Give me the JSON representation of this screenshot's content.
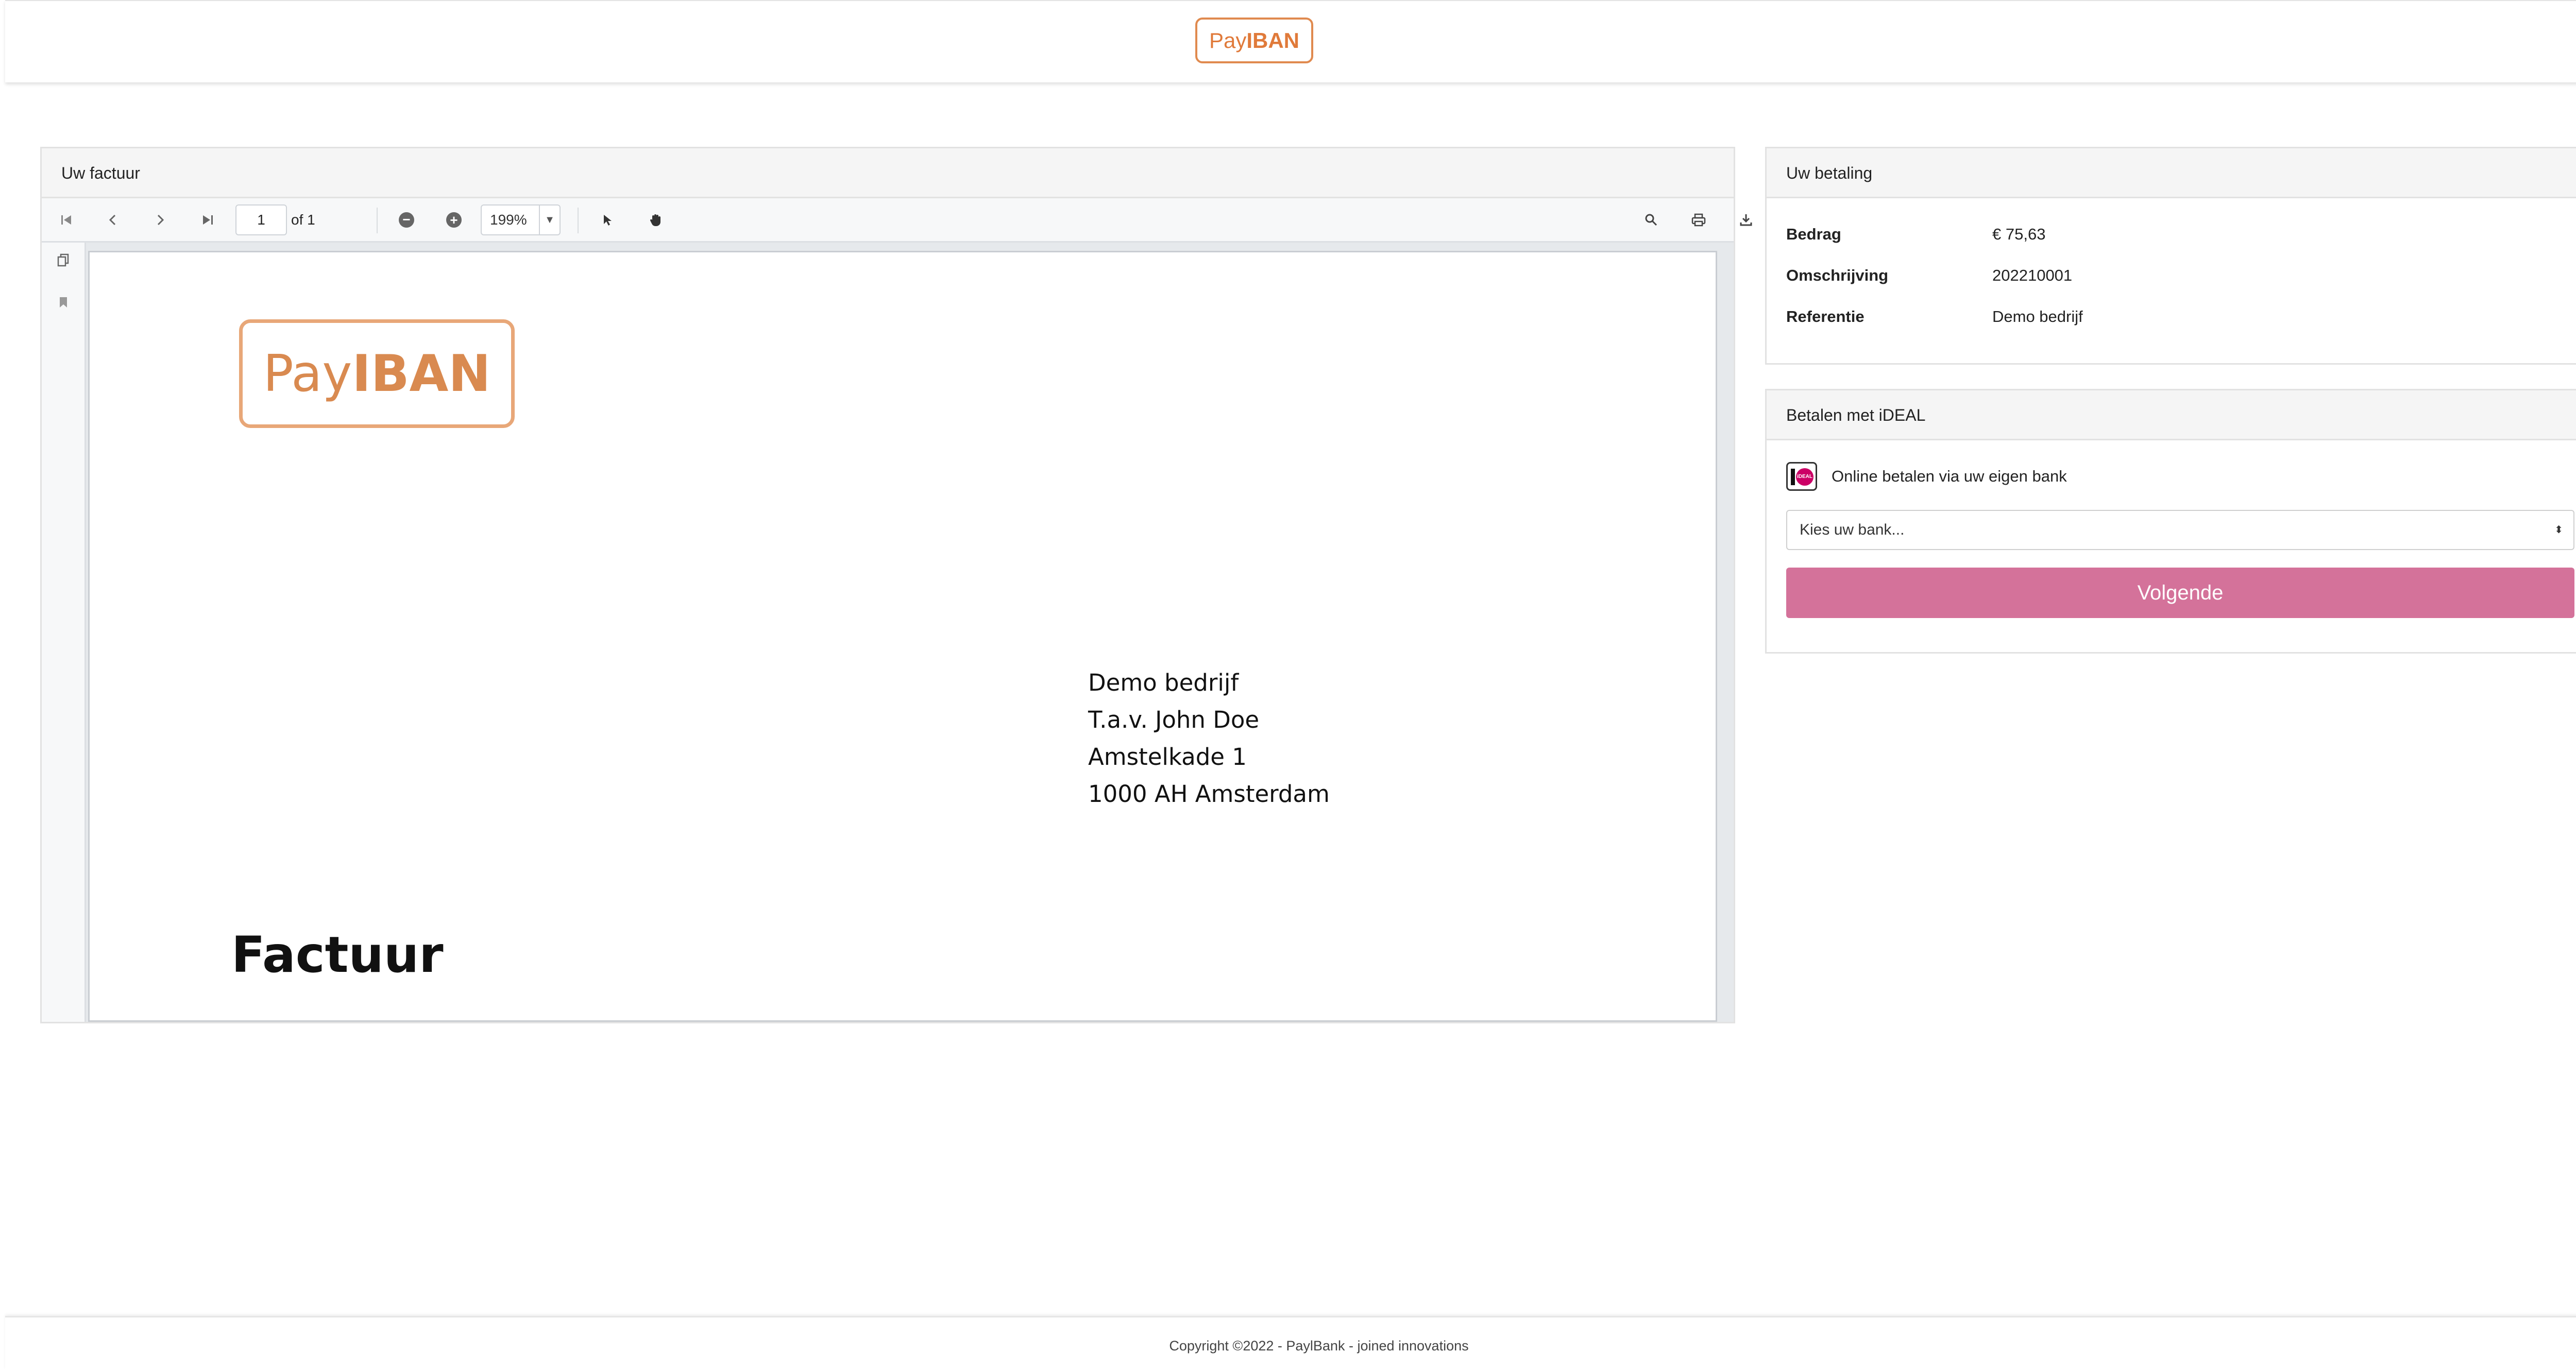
{
  "header": {
    "logo": {
      "pay": "Pay",
      "iban": "IBAN",
      "color": "#e07a3a"
    }
  },
  "invoice_panel": {
    "title": "Uw factuur",
    "toolbar": {
      "page_number": "1",
      "page_of": "of 1",
      "zoom": "199%",
      "icons": [
        "first-page-icon",
        "previous-page-icon",
        "next-page-icon",
        "last-page-icon",
        "zoom-out-icon",
        "zoom-in-icon",
        "text-select-icon",
        "hand-tool-icon",
        "search-icon",
        "print-icon",
        "download-icon"
      ]
    },
    "sidebar_icons": [
      "thumbnails-icon",
      "bookmark-icon"
    ],
    "document": {
      "logo": {
        "pay": "Pay",
        "iban": "IBAN"
      },
      "address": [
        "Demo bedrijf",
        "T.a.v. John Doe",
        "Amstelkade 1",
        "1000 AH Amsterdam"
      ],
      "title": "Factuur"
    }
  },
  "payment_panel": {
    "title": "Uw betaling",
    "rows": [
      {
        "label": "Bedrag",
        "value": "€ 75,63"
      },
      {
        "label": "Omschrijving",
        "value": "202210001"
      },
      {
        "label": "Referentie",
        "value": "Demo bedrijf"
      }
    ]
  },
  "ideal_panel": {
    "title": "Betalen met iDEAL",
    "description": "Online betalen via uw eigen bank",
    "bank_select": "Kies uw bank...",
    "next_button": "Volgende",
    "button_color": "#d4729a"
  },
  "footer": {
    "copyright": "Copyright ©2022 - PaylBank - joined innovations"
  }
}
